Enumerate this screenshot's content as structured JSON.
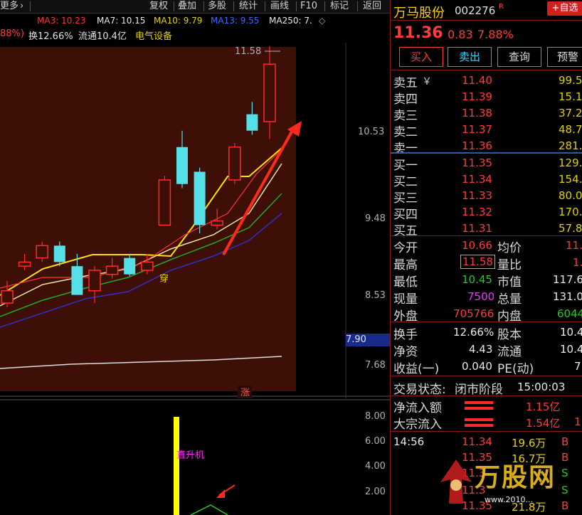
{
  "toolbar": {
    "items": [
      "更多",
      "复权",
      "叠加",
      "多股",
      "统计",
      "画线",
      "F10",
      "标记",
      "返回"
    ]
  },
  "ma_legend": {
    "ma3": "MA3: 10.23",
    "ma7": "MA7: 10.15",
    "ma10": "MA10: 9.79",
    "ma13": "MA13: 9.55",
    "ma250": "MA250: 7.",
    "colors": {
      "ma3": "#ff3333",
      "ma7": "#e8e8e8",
      "ma10": "#e6d200",
      "ma13": "#33cc33",
      "ma250": "#6666ff"
    }
  },
  "info": {
    "pct": "88%)",
    "turnover": "换12.66%",
    "float_cap": "流通10.4亿",
    "sector": "电气设备"
  },
  "chart_data": {
    "type": "candlestick",
    "price_axis": [
      "10.53",
      "9.48",
      "8.53",
      "7.68"
    ],
    "current_price_tag": "7.90",
    "high_label": "11.58",
    "annotations": {
      "chuan": "穿",
      "zhang": "涨"
    },
    "candles": [
      {
        "o": 8.45,
        "c": 8.6,
        "h": 8.72,
        "l": 8.4,
        "up": true
      },
      {
        "o": 8.9,
        "c": 8.95,
        "h": 9.05,
        "l": 8.85,
        "up": true
      },
      {
        "o": 9.0,
        "c": 9.15,
        "h": 9.2,
        "l": 8.95,
        "up": true
      },
      {
        "o": 9.15,
        "c": 8.95,
        "h": 9.2,
        "l": 8.9,
        "up": false
      },
      {
        "o": 8.9,
        "c": 8.55,
        "h": 9.05,
        "l": 8.55,
        "up": false
      },
      {
        "o": 8.6,
        "c": 8.85,
        "h": 8.9,
        "l": 8.45,
        "up": true
      },
      {
        "o": 8.8,
        "c": 8.9,
        "h": 9.0,
        "l": 8.75,
        "up": true
      },
      {
        "o": 9.0,
        "c": 8.8,
        "h": 9.05,
        "l": 8.78,
        "up": false
      },
      {
        "o": 8.85,
        "c": 8.95,
        "h": 9.05,
        "l": 8.8,
        "up": true
      },
      {
        "o": 9.4,
        "c": 9.95,
        "h": 10.0,
        "l": 9.4,
        "up": true
      },
      {
        "o": 10.35,
        "c": 9.9,
        "h": 10.55,
        "l": 9.85,
        "up": false
      },
      {
        "o": 10.05,
        "c": 9.4,
        "h": 10.1,
        "l": 9.3,
        "up": false
      },
      {
        "o": 9.45,
        "c": 9.4,
        "h": 9.6,
        "l": 9.35,
        "up": true
      },
      {
        "o": 9.95,
        "c": 10.35,
        "h": 10.4,
        "l": 9.9,
        "up": true
      },
      {
        "o": 10.55,
        "c": 10.75,
        "h": 10.9,
        "l": 10.5,
        "up": false
      },
      {
        "o": 10.66,
        "c": 11.36,
        "h": 11.58,
        "l": 10.45,
        "up": true
      }
    ],
    "sub_axis": [
      "8.00",
      "6.00",
      "4.00",
      "2.00"
    ],
    "sub_label": "直升机"
  },
  "stock": {
    "name": "万马股份",
    "code": "002276",
    "flag": "R",
    "add_watch": "+自选",
    "price": "11.36",
    "change": "0.83",
    "change_pct": "7.88%"
  },
  "buttons": [
    "买入",
    "卖出",
    "查询",
    "预警"
  ],
  "orderbook": {
    "sell": [
      {
        "label": "卖五",
        "price": "11.40",
        "vol": "99.5"
      },
      {
        "label": "卖四",
        "price": "11.39",
        "vol": "15.1"
      },
      {
        "label": "卖三",
        "price": "11.38",
        "vol": "37.2"
      },
      {
        "label": "卖二",
        "price": "11.37",
        "vol": "48.7"
      },
      {
        "label": "卖一",
        "price": "11.36",
        "vol": "281.8"
      }
    ],
    "buy": [
      {
        "label": "买一",
        "price": "11.35",
        "vol": "129.4"
      },
      {
        "label": "买二",
        "price": "11.34",
        "vol": "154.7"
      },
      {
        "label": "买三",
        "price": "11.33",
        "vol": "80.0"
      },
      {
        "label": "买四",
        "price": "11.32",
        "vol": "170.5"
      },
      {
        "label": "买五",
        "price": "11.31",
        "vol": "57.8"
      }
    ],
    "sell_mark": "￥"
  },
  "stats": {
    "open_l": "今开",
    "open_v": "10.66",
    "avg_l": "均价",
    "avg_v": "11.",
    "high_l": "最高",
    "high_v": "11.58",
    "vr_l": "量比",
    "vr_v": "1.",
    "low_l": "最低",
    "low_v": "10.45",
    "mcap_l": "市值",
    "mcap_v": "117.6",
    "now_l": "现量",
    "now_v": "7500",
    "tvol_l": "总量",
    "tvol_v": "131.0",
    "out_l": "外盘",
    "out_v": "705766",
    "in_l": "内盘",
    "in_v": "6044",
    "turn_l": "换手",
    "turn_v": "12.66%",
    "share_l": "股本",
    "share_v": "10.4",
    "nav_l": "净资",
    "nav_v": "4.43",
    "float_l": "流通",
    "float_v": "10.4",
    "eps_l": "收益(一)",
    "eps_v": "0.040",
    "pe_l": "PE(动)",
    "pe_v": "7"
  },
  "status": {
    "label": "交易状态:",
    "value": "闭市阶段",
    "time": "15:00:03"
  },
  "flow": {
    "net_l": "净流入额",
    "net_v": "1.15亿",
    "block_l": "大宗流入",
    "block_v": "1.54亿",
    "block_extra": "1"
  },
  "ticks": [
    {
      "time": "14:56",
      "price": "11.34",
      "vol": "19.6万",
      "side": "B"
    },
    {
      "time": "",
      "price": "11.35",
      "vol": "16.7万",
      "side": "B"
    },
    {
      "time": "",
      "price": "11.3",
      "vol": "",
      "side": "S"
    },
    {
      "time": "",
      "price": "11.3",
      "vol": "",
      "side": "S"
    },
    {
      "time": "",
      "price": "11.35",
      "vol": "21.8万",
      "side": "B"
    }
  ],
  "watermark": {
    "text": "万股网",
    "url": "www.2010..."
  }
}
